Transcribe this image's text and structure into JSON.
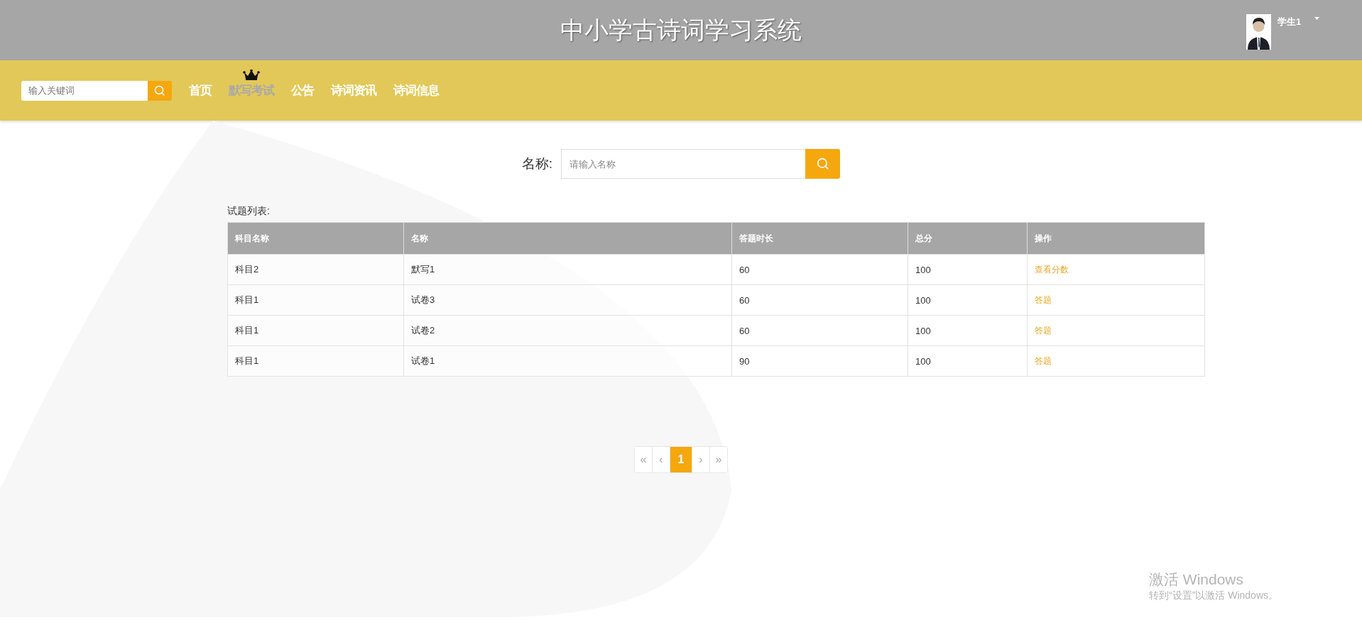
{
  "header": {
    "title": "中小学古诗词学习系统",
    "user": {
      "name": "学生1"
    }
  },
  "nav": {
    "search": {
      "placeholder": "输入关键词"
    },
    "items": [
      {
        "label": "首页",
        "selected": false
      },
      {
        "label": "默写考试",
        "selected": true
      },
      {
        "label": "公告",
        "selected": false
      },
      {
        "label": "诗词资讯",
        "selected": false
      },
      {
        "label": "诗词信息",
        "selected": false
      }
    ]
  },
  "filter": {
    "label": "名称:",
    "placeholder": "请输入名称"
  },
  "table": {
    "caption": "试题列表:",
    "columns": [
      "科目名称",
      "名称",
      "答题时长",
      "总分",
      "操作"
    ],
    "rows": [
      {
        "cells": [
          "科目2",
          "默写1",
          "60",
          "100"
        ],
        "action": "查看分数"
      },
      {
        "cells": [
          "科目1",
          "试卷3",
          "60",
          "100"
        ],
        "action": "答题"
      },
      {
        "cells": [
          "科目1",
          "试卷2",
          "60",
          "100"
        ],
        "action": "答题"
      },
      {
        "cells": [
          "科目1",
          "试卷1",
          "90",
          "100"
        ],
        "action": "答题"
      }
    ]
  },
  "pagination": {
    "first": "«",
    "prev": "‹",
    "pages": [
      {
        "label": "1",
        "selected": true
      }
    ],
    "next": "›",
    "last": "»"
  },
  "os_notice": {
    "title": "激活 Windows",
    "text": "转到“设置”以激活 Windows。"
  }
}
